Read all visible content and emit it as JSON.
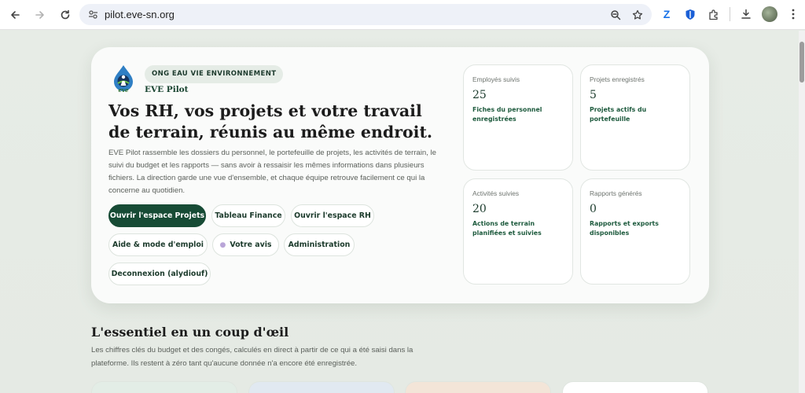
{
  "browser": {
    "url": "pilot.eve-sn.org",
    "icons": [
      "back-arrow-icon",
      "forward-arrow-icon",
      "reload-icon",
      "site-settings-icon",
      "zoom-icon",
      "bookmark-star-icon",
      "zotero-extension-icon",
      "bitwarden-shield-icon",
      "extensions-puzzle-icon",
      "download-icon",
      "profile-avatar",
      "kebab-menu-icon"
    ]
  },
  "hero": {
    "org_badge": "ONG EAU VIE ENVIRONNEMENT",
    "app_name": "EVE Pilot",
    "headline": "Vos RH, vos projets et votre travail de terrain, réunis au même endroit.",
    "description": "EVE Pilot rassemble les dossiers du personnel, le portefeuille de projets, les activités de terrain, le suivi du budget et les rapports — sans avoir à ressaisir les mêmes informations dans plusieurs fichiers. La direction garde une vue d'ensemble, et chaque équipe retrouve facilement ce qui la concerne au quotidien.",
    "buttons": {
      "projects": "Ouvrir l'espace Projets",
      "finance": "Tableau Finance",
      "hr": "Ouvrir l'espace RH",
      "help": "Aide & mode d'emploi",
      "feedback": "Votre avis",
      "admin": "Administration",
      "logout": "Deconnexion (alydiouf)"
    }
  },
  "stats": [
    {
      "label": "Employés suivis",
      "value": "25",
      "caption": "Fiches du personnel enregistrées"
    },
    {
      "label": "Projets enregistrés",
      "value": "5",
      "caption": "Projets actifs du portefeuille"
    },
    {
      "label": "Activités suivies",
      "value": "20",
      "caption": "Actions de terrain planifiées et suivies"
    },
    {
      "label": "Rapports générés",
      "value": "0",
      "caption": "Rapports et exports disponibles"
    }
  ],
  "section": {
    "title": "L'essentiel en un coup d'œil",
    "description": "Les chiffres clés du budget et des congés, calculés en direct à partir de ce qui a été saisi dans la plateforme. Ils restent à zéro tant qu'aucune donnée n'a encore été enregistrée."
  },
  "colors": {
    "primary": "#174b35",
    "accent_text": "#1d5a3d",
    "card_peeks": [
      "#e3ede6",
      "#e1e9f1",
      "#f3e5d8",
      "#ffffff"
    ]
  }
}
